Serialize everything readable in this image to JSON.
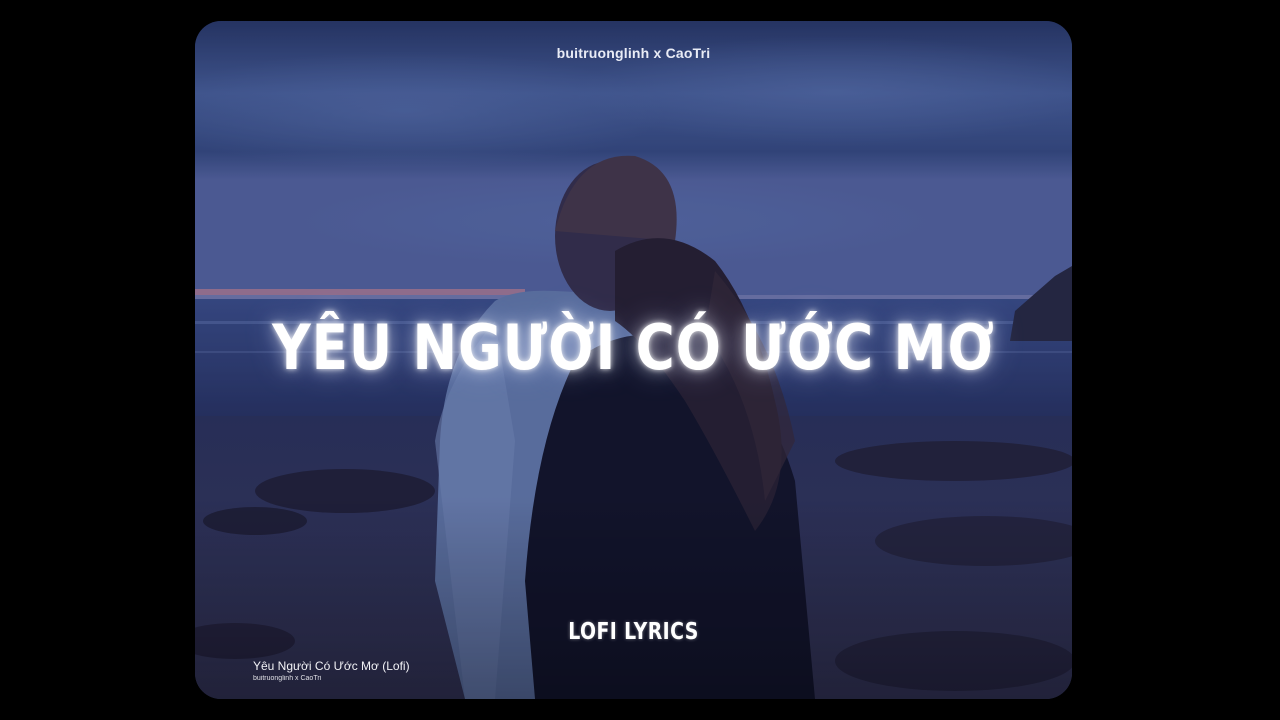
{
  "artists_header": "buitruonglinh x CaoTri",
  "song_title": "YÊU NGƯỜI CÓ ƯỚC MƠ",
  "channel_label": "LOFI LYRICS",
  "now_playing": {
    "title": "Yêu Người Có Ước Mơ (Lofi)",
    "artist": "buitruonglinh x CaoTri"
  },
  "colors": {
    "background": "#000000",
    "sky": "#4a5f9e",
    "text": "#ffffff"
  }
}
